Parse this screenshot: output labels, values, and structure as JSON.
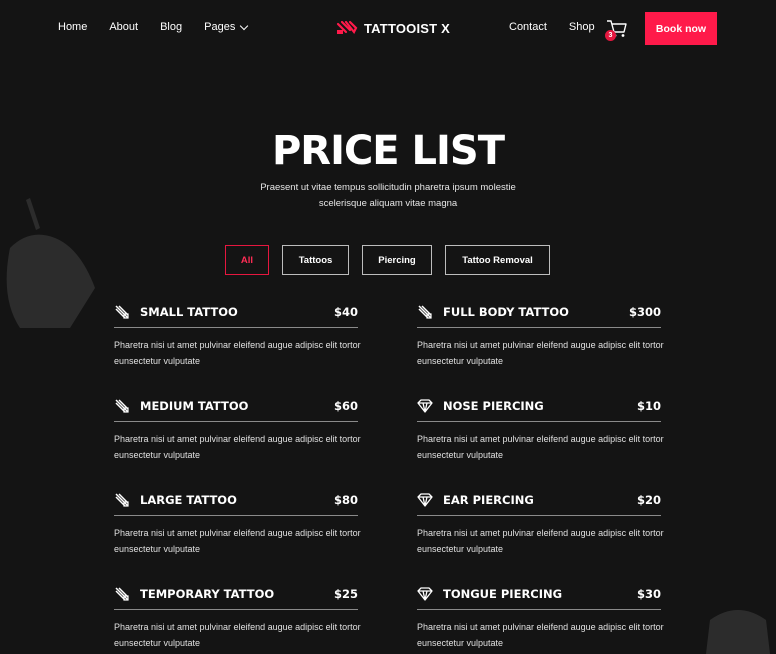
{
  "nav": {
    "left": [
      "Home",
      "About",
      "Blog",
      "Pages"
    ],
    "brand": "TATTOOIST X",
    "right": [
      "Contact",
      "Shop"
    ],
    "cart_count": "3",
    "cta": "Book now"
  },
  "hero": {
    "title": "PRICE LIST",
    "subtitle": "Praesent ut vitae tempus sollicitudin pharetra ipsum molestie scelerisque aliquam vitae magna"
  },
  "tabs": [
    "All",
    "Tattoos",
    "Piercing",
    "Tattoo Removal"
  ],
  "items": [
    {
      "name": "SMALL TATTOO",
      "price": "$40",
      "icon": "tattoo-machine-icon",
      "desc": "Pharetra nisi ut amet pulvinar eleifend augue adipisc elit tortor eunsectetur vulputate"
    },
    {
      "name": "FULL BODY TATTOO",
      "price": "$300",
      "icon": "tattoo-machine-icon",
      "desc": "Pharetra nisi ut amet pulvinar eleifend augue adipisc elit tortor eunsectetur vulputate"
    },
    {
      "name": "MEDIUM TATTOO",
      "price": "$60",
      "icon": "tattoo-machine-icon",
      "desc": "Pharetra nisi ut amet pulvinar eleifend augue adipisc elit tortor eunsectetur vulputate"
    },
    {
      "name": "NOSE PIERCING",
      "price": "$10",
      "icon": "diamond-icon",
      "desc": "Pharetra nisi ut amet pulvinar eleifend augue adipisc elit tortor eunsectetur vulputate"
    },
    {
      "name": "LARGE TATTOO",
      "price": "$80",
      "icon": "tattoo-machine-icon",
      "desc": "Pharetra nisi ut amet pulvinar eleifend augue adipisc elit tortor eunsectetur vulputate"
    },
    {
      "name": "EAR PIERCING",
      "price": "$20",
      "icon": "diamond-icon",
      "desc": "Pharetra nisi ut amet pulvinar eleifend augue adipisc elit tortor eunsectetur vulputate"
    },
    {
      "name": "TEMPORARY TATTOO",
      "price": "$25",
      "icon": "tattoo-machine-icon",
      "desc": "Pharetra nisi ut amet pulvinar eleifend augue adipisc elit tortor eunsectetur vulputate"
    },
    {
      "name": "TONGUE PIERCING",
      "price": "$30",
      "icon": "diamond-icon",
      "desc": "Pharetra nisi ut amet pulvinar eleifend augue adipisc elit tortor eunsectetur vulputate"
    }
  ],
  "colors": {
    "background": "#141414",
    "accent": "#ff1a4a",
    "text": "#ffffff"
  }
}
